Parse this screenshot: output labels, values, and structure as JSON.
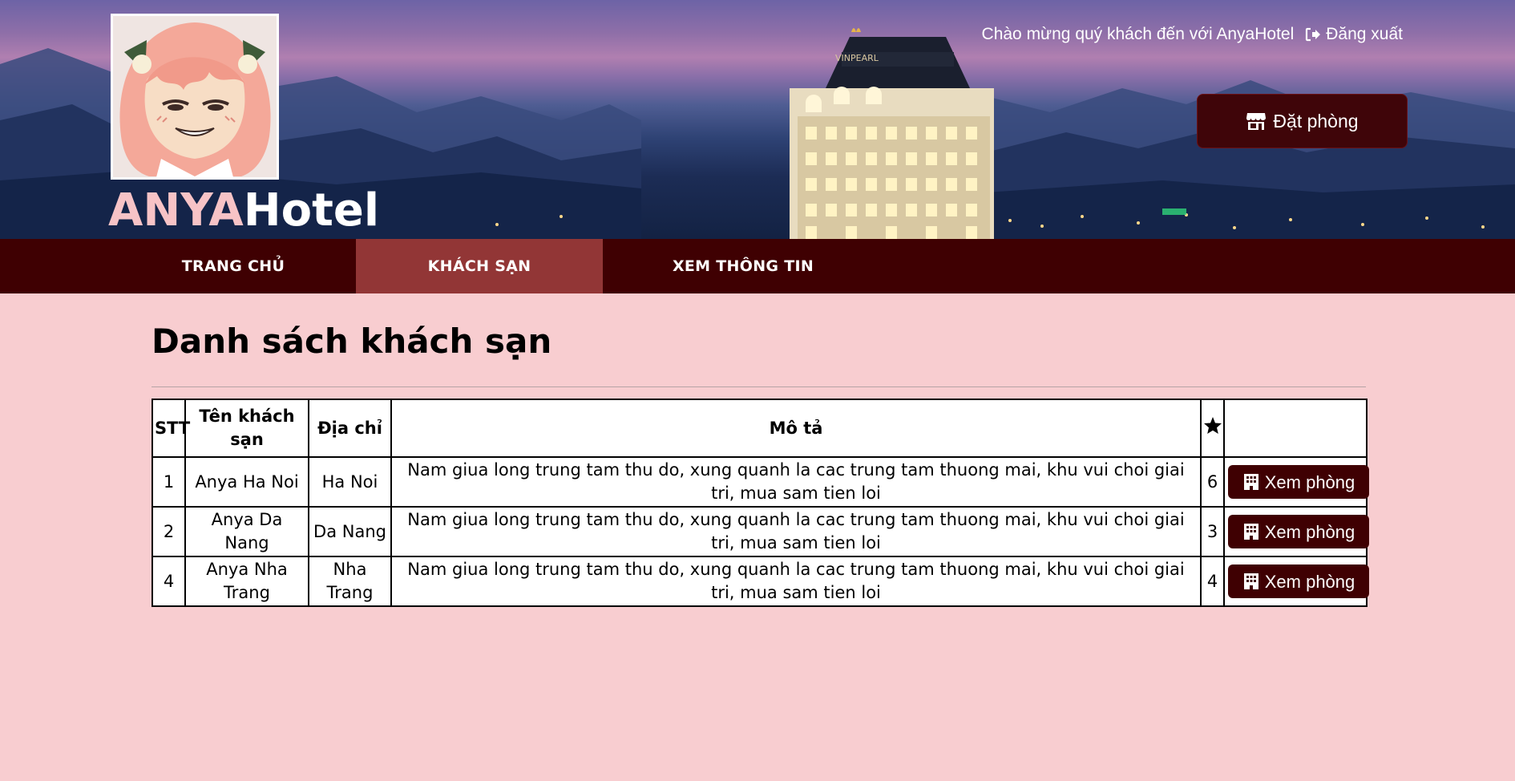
{
  "header": {
    "brand_part1": "ANYA",
    "brand_part2": "Hotel",
    "welcome_text": "Chào mừng quý khách đến với AnyaHotel",
    "logout_label": "Đăng xuất",
    "book_button_label": "Đặt phòng",
    "hotel_sign": "VINPEARL"
  },
  "nav": {
    "items": [
      {
        "label": "TRANG CHỦ",
        "active": false
      },
      {
        "label": "KHÁCH SẠN",
        "active": true
      },
      {
        "label": "XEM THÔNG TIN",
        "active": false
      }
    ]
  },
  "main": {
    "title": "Danh sách khách sạn",
    "table": {
      "headers": [
        "STT",
        "Tên khách sạn",
        "Địa chỉ",
        "Mô tả",
        "star-icon",
        ""
      ],
      "rows": [
        {
          "stt": "1",
          "name": "Anya Ha Noi",
          "address": "Ha Noi",
          "description": "Nam giua long trung tam thu do, xung quanh la cac trung tam thuong mai, khu vui choi giai tri, mua sam tien loi",
          "stars": "6",
          "action": "Xem phòng"
        },
        {
          "stt": "2",
          "name": "Anya Da Nang",
          "address": "Da Nang",
          "description": "Nam giua long trung tam thu do, xung quanh la cac trung tam thuong mai, khu vui choi giai tri, mua sam tien loi",
          "stars": "3",
          "action": "Xem phòng"
        },
        {
          "stt": "4",
          "name": "Anya Nha Trang",
          "address": "Nha Trang",
          "description": "Nam giua long trung tam thu do, xung quanh la cac trung tam thuong mai, khu vui choi giai tri, mua sam tien loi",
          "stars": "4",
          "action": "Xem phòng"
        }
      ]
    }
  },
  "colors": {
    "nav_bg": "#3f0002",
    "nav_active": "#923636",
    "page_bg": "#f8cdd0",
    "brand_pink": "#f7c3c6",
    "button_bg": "#3f0509"
  }
}
